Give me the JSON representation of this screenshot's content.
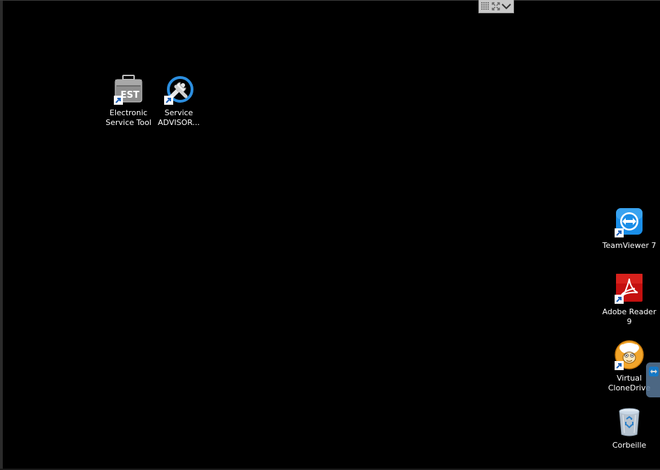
{
  "session_toolbar": {
    "buttons": [
      "grid-icon",
      "fit-screen-icon",
      "chevron-down-icon"
    ]
  },
  "desktop_icons": {
    "est": {
      "line1": "Electronic",
      "line2": "Service Tool",
      "icon": "toolbox-est-icon"
    },
    "service_advisor": {
      "line1": "Service",
      "line2": "ADVISOR...",
      "icon": "wrench-icon"
    },
    "teamviewer": {
      "line1": "TeamViewer 7",
      "icon": "teamviewer-icon"
    },
    "adobe_reader": {
      "line1": "Adobe Reader",
      "line2": "9",
      "icon": "adobe-reader-icon"
    },
    "virtual_clonedrive": {
      "line1": "Virtual",
      "line2": "CloneDrive",
      "icon": "sheep-icon"
    },
    "recycle_bin": {
      "line1": "Corbeille",
      "icon": "recycle-bin-icon"
    }
  },
  "colors": {
    "desktop_background": "#000000",
    "teamviewer_blue": "#1a8ee8",
    "adobe_red": "#c4100f",
    "clonedrive_orange": "#f2a52a"
  }
}
